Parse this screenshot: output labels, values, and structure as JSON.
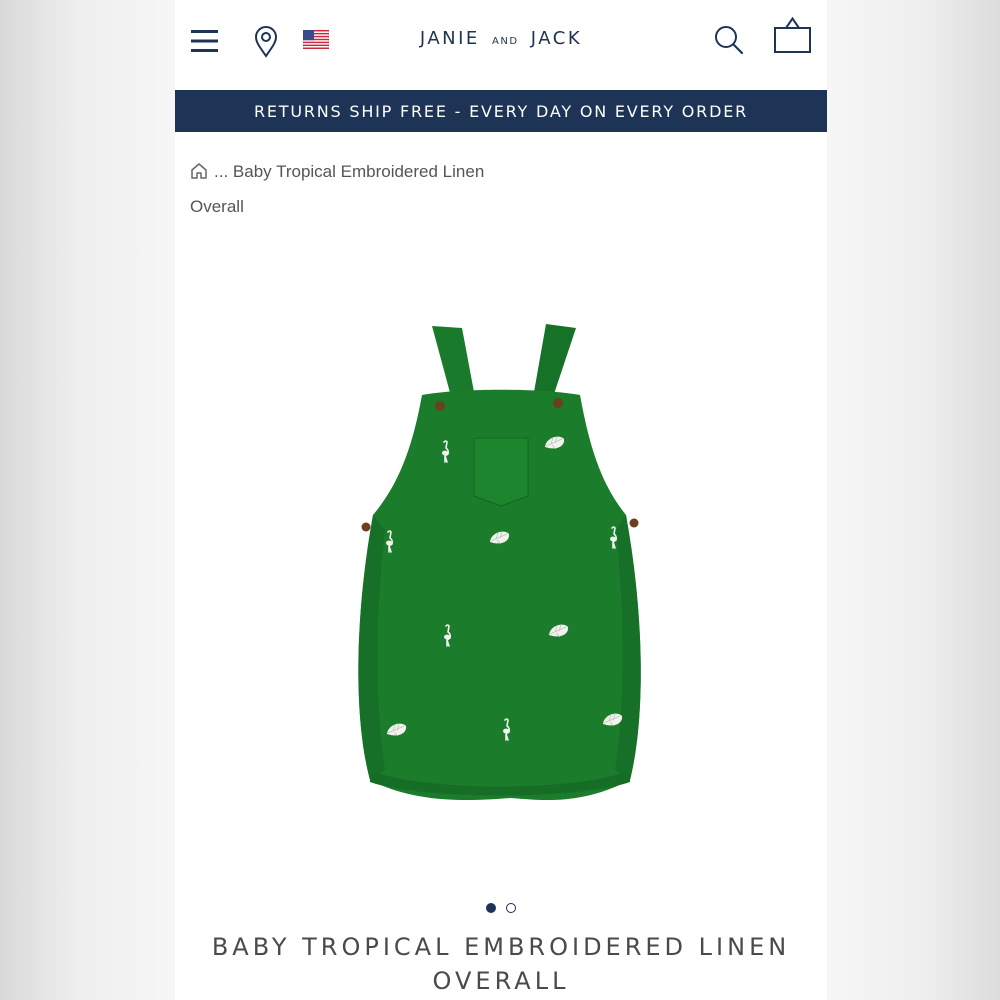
{
  "header": {
    "logo_main_left": "JANIE",
    "logo_small": "AND",
    "logo_main_right": "JACK",
    "icons": [
      "menu-icon",
      "location-pin-icon",
      "us-flag-icon",
      "search-icon",
      "shopping-bag-icon"
    ]
  },
  "banner": {
    "text": "RETURNS SHIP FREE - EVERY DAY ON EVERY ORDER"
  },
  "breadcrumb": {
    "ellipsis": "...",
    "current": "Baby Tropical Embroidered Linen Overall"
  },
  "carousel": {
    "slides": 2,
    "active_index": 1
  },
  "product": {
    "title": "BABY TROPICAL EMBROIDERED LINEN OVERALL"
  },
  "colors": {
    "brand_navy": "#1d3457",
    "product_green": "#1a7a2b"
  }
}
